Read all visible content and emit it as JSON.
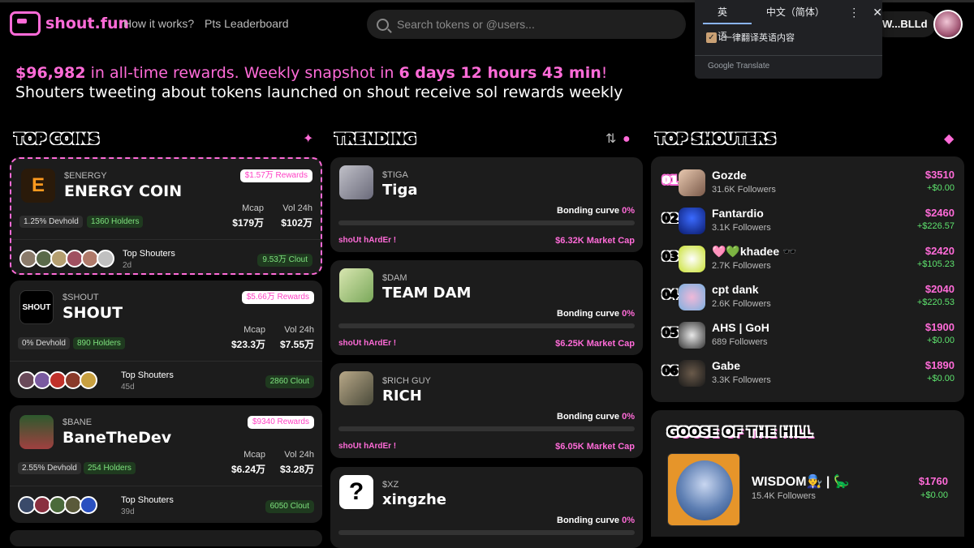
{
  "header": {
    "logo_text": "shout.fun",
    "nav": [
      "How it works?",
      "Pts Leaderboard"
    ],
    "search_placeholder": "Search tokens or @users...",
    "wallet": "W...BLLd"
  },
  "translate_popup": {
    "tabs": [
      "英语",
      "中文（简体）"
    ],
    "more": "⋮",
    "close": "✕",
    "option": "一律翻译英语内容",
    "footer": "Google Translate"
  },
  "headline": {
    "amount": "$96,982",
    "mid": " in all-time rewards. Weekly snapshot in ",
    "countdown": "6 days 12 hours 43 min",
    "bang": "!",
    "line2": "Shouters tweeting about tokens launched on shout receive sol rewards weekly"
  },
  "sections": {
    "top_coins": "TOP COINS",
    "trending": "TRENDING",
    "top_shouters": "TOP SHOUTERS",
    "goose": "GOOSE OF THE HILL"
  },
  "colors": {
    "accent": "#ff6bd8",
    "positive": "#5ee36e",
    "card": "#1c1c1c"
  },
  "top_coins": [
    {
      "ticker": "$ENERGY",
      "name": "ENERGY COIN",
      "rewards": "$1.57万 Rewards",
      "mcap_label": "Mcap",
      "mcap": "$179万",
      "vol_label": "Vol 24h",
      "vol": "$102万",
      "devhold": "1.25% Devhold",
      "holders": "1360 Holders",
      "shouters_label": "Top Shouters",
      "age": "2d",
      "clout": "9.53万 Clout",
      "logo": "E"
    },
    {
      "ticker": "$SHOUT",
      "name": "SHOUT",
      "rewards": "$5.66万 Rewards",
      "mcap_label": "Mcap",
      "mcap": "$23.3万",
      "vol_label": "Vol 24h",
      "vol": "$7.55万",
      "devhold": "0% Devhold",
      "holders": "890 Holders",
      "shouters_label": "Top Shouters",
      "age": "45d",
      "clout": "2860 Clout",
      "logo": "SHOUT"
    },
    {
      "ticker": "$BANE",
      "name": "BaneTheDev",
      "rewards": "$9340 Rewards",
      "mcap_label": "Mcap",
      "mcap": "$6.24万",
      "vol_label": "Vol 24h",
      "vol": "$3.28万",
      "devhold": "2.55% Devhold",
      "holders": "254 Holders",
      "shouters_label": "Top Shouters",
      "age": "39d",
      "clout": "6050 Clout",
      "logo": ""
    }
  ],
  "trending": [
    {
      "ticker": "$TIGA",
      "name": "Tiga",
      "bonding_label": "Bonding curve",
      "bonding": "0%",
      "bonding_fill": 0,
      "slogan": "shoUt hArdEr !",
      "mcap": "$6.32K Market Cap"
    },
    {
      "ticker": "$DAM",
      "name": "TEAM DAM",
      "bonding_label": "Bonding curve",
      "bonding": "0%",
      "bonding_fill": 0,
      "slogan": "shoUt hArdEr !",
      "mcap": "$6.25K Market Cap"
    },
    {
      "ticker": "$RICH GUY",
      "name": "RICH",
      "bonding_label": "Bonding curve",
      "bonding": "0%",
      "bonding_fill": 0,
      "slogan": "shoUt hArdEr !",
      "mcap": "$6.05K Market Cap"
    },
    {
      "ticker": "$XZ",
      "name": "xingzhe",
      "bonding_label": "Bonding curve",
      "bonding": "0%",
      "bonding_fill": 0,
      "logo": "?"
    }
  ],
  "top_shouters": [
    {
      "rank": "01",
      "name": "Gozde",
      "followers": "31.6K Followers",
      "amount": "$3510",
      "delta": "+$0.00"
    },
    {
      "rank": "02",
      "name": "Fantardio",
      "followers": "3.1K Followers",
      "amount": "$2460",
      "delta": "+$226.57"
    },
    {
      "rank": "03",
      "name": "🩷💚khadee 🕶️",
      "followers": "2.7K Followers",
      "amount": "$2420",
      "delta": "+$105.23"
    },
    {
      "rank": "04",
      "name": "cpt dank",
      "followers": "2.6K Followers",
      "amount": "$2040",
      "delta": "+$220.53"
    },
    {
      "rank": "05",
      "name": "AHS | GoH",
      "followers": "689 Followers",
      "amount": "$1900",
      "delta": "+$0.00"
    },
    {
      "rank": "06",
      "name": "Gabe",
      "followers": "3.3K Followers",
      "amount": "$1890",
      "delta": "+$0.00"
    }
  ],
  "goose": {
    "name": "WISDOM👨‍🔧 | 🦕",
    "followers": "15.4K Followers",
    "amount": "$1760",
    "delta": "+$0.00"
  }
}
